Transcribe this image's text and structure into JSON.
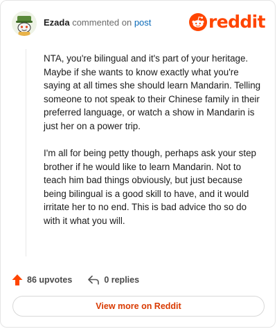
{
  "header": {
    "username": "Ezada",
    "action_text": "commented on",
    "post_link": "post"
  },
  "brand": {
    "logo_text": "reddit",
    "color": "#ff4500"
  },
  "comment": {
    "paragraphs": [
      "NTA, you're bilingual and it's part of your heritage. Maybe if she wants to know exactly what you're saying at all times she should learn Mandarin. Telling someone to not speak to their Chinese family in their preferred language, or watch a show in Mandarin is just her on a power trip.",
      "I'm all for being petty though, perhaps ask your step brother if he would like to learn Mandarin. Not to teach him bad things obviously, but just because being bilingual is a good skill to have, and it would irritate her to no end. This is bad advice tho so do with it what you will."
    ]
  },
  "actions": {
    "upvotes": "86 upvotes",
    "replies": "0 replies"
  },
  "footer": {
    "view_more": "View more on Reddit"
  }
}
